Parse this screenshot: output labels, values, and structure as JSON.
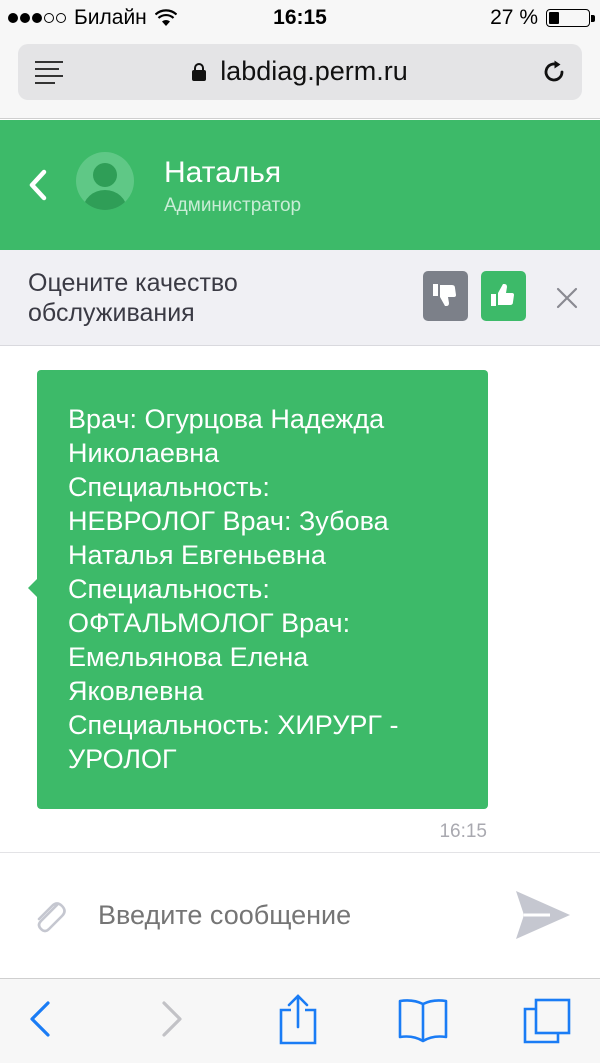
{
  "status_bar": {
    "carrier": "Билайн",
    "time": "16:15",
    "battery": "27 %",
    "battery_level": 0.27,
    "signal_bars_filled": 3,
    "signal_bars_total": 5
  },
  "browser": {
    "url": "labdiag.perm.ru"
  },
  "chat_header": {
    "name": "Наталья",
    "role": "Администратор"
  },
  "rating": {
    "prompt": "Оцените качество обслуживания"
  },
  "messages": [
    {
      "text": "Врач: Огурцова Надежда\nНиколаевна\nСпециальность:\nНЕВРОЛОГ Врач: Зубова\nНаталья Евгеньевна\nСпециальность:\nОФТАЛЬМОЛОГ Врач:\nЕмельянова Елена\nЯковлевна\nСпециальность: ХИРУРГ -\nУРОЛОГ",
      "time": "16:15"
    }
  ],
  "composer": {
    "placeholder": "Введите сообщение"
  },
  "colors": {
    "accent": "#3dba69",
    "thumb_down": "#7c8089"
  }
}
